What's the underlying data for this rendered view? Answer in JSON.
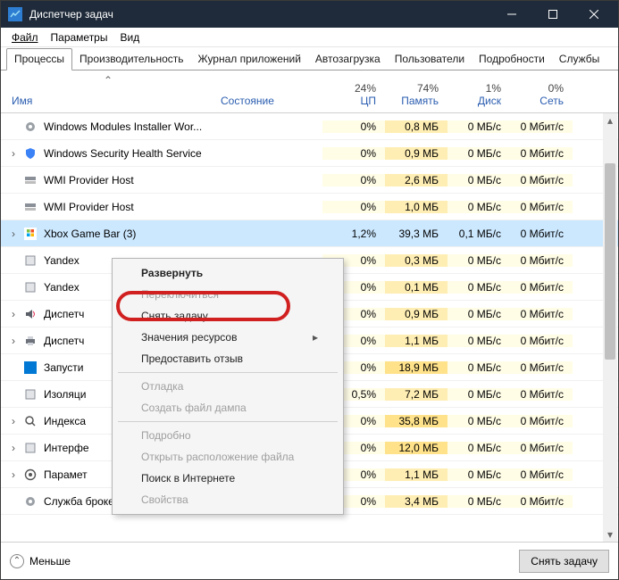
{
  "window": {
    "title": "Диспетчер задач"
  },
  "menu": {
    "file": "Файл",
    "options": "Параметры",
    "view": "Вид"
  },
  "tabs": [
    {
      "label": "Процессы"
    },
    {
      "label": "Производительность"
    },
    {
      "label": "Журнал приложений"
    },
    {
      "label": "Автозагрузка"
    },
    {
      "label": "Пользователи"
    },
    {
      "label": "Подробности"
    },
    {
      "label": "Службы"
    }
  ],
  "columns": {
    "name": "Имя",
    "status": "Состояние",
    "cpu": {
      "pct": "24%",
      "label": "ЦП"
    },
    "memory": {
      "pct": "74%",
      "label": "Память"
    },
    "disk": {
      "pct": "1%",
      "label": "Диск"
    },
    "network": {
      "pct": "0%",
      "label": "Сеть"
    }
  },
  "rows": [
    {
      "expand": "",
      "name": "Windows Modules Installer Wor...",
      "cpu": "0%",
      "mem": "0,8 МБ",
      "disk": "0 МБ/с",
      "net": "0 Мбит/с",
      "m": "1",
      "icon": "cog"
    },
    {
      "expand": "›",
      "name": "Windows Security Health Service",
      "cpu": "0%",
      "mem": "0,9 МБ",
      "disk": "0 МБ/с",
      "net": "0 Мбит/с",
      "m": "1",
      "icon": "shield"
    },
    {
      "expand": "",
      "name": "WMI Provider Host",
      "cpu": "0%",
      "mem": "2,6 МБ",
      "disk": "0 МБ/с",
      "net": "0 Мбит/с",
      "m": "1",
      "icon": "srv"
    },
    {
      "expand": "",
      "name": "WMI Provider Host",
      "cpu": "0%",
      "mem": "1,0 МБ",
      "disk": "0 МБ/с",
      "net": "0 Мбит/с",
      "m": "1",
      "icon": "srv"
    },
    {
      "expand": "›",
      "name": "Xbox Game Bar (3)",
      "cpu": "1,2%",
      "mem": "39,3 МБ",
      "disk": "0,1 МБ/с",
      "net": "0 Мбит/с",
      "m": "2",
      "icon": "xbox",
      "selected": true
    },
    {
      "expand": "",
      "name": "Yandex",
      "cpu": "0%",
      "mem": "0,3 МБ",
      "disk": "0 МБ/с",
      "net": "0 Мбит/с",
      "m": "1",
      "icon": "app"
    },
    {
      "expand": "",
      "name": "Yandex",
      "cpu": "0%",
      "mem": "0,1 МБ",
      "disk": "0 МБ/с",
      "net": "0 Мбит/с",
      "m": "1",
      "icon": "app"
    },
    {
      "expand": "›",
      "name": "Диспетч",
      "cpu": "0%",
      "mem": "0,9 МБ",
      "disk": "0 МБ/с",
      "net": "0 Мбит/с",
      "m": "1",
      "icon": "snd"
    },
    {
      "expand": "›",
      "name": "Диспетч",
      "cpu": "0%",
      "mem": "1,1 МБ",
      "disk": "0 МБ/с",
      "net": "0 Мбит/с",
      "m": "1",
      "icon": "prn"
    },
    {
      "expand": "",
      "name": "Запусти",
      "cpu": "0%",
      "mem": "18,9 МБ",
      "disk": "0 МБ/с",
      "net": "0 Мбит/с",
      "m": "2",
      "icon": "win"
    },
    {
      "expand": "",
      "name": "Изоляци",
      "cpu": "0,5%",
      "mem": "7,2 МБ",
      "disk": "0 МБ/с",
      "net": "0 Мбит/с",
      "m": "1",
      "icon": "app"
    },
    {
      "expand": "›",
      "name": "Индекса",
      "cpu": "0%",
      "mem": "35,8 МБ",
      "disk": "0 МБ/с",
      "net": "0 Мбит/с",
      "m": "2",
      "icon": "idx"
    },
    {
      "expand": "›",
      "name": "Интерфе",
      "cpu": "0%",
      "mem": "12,0 МБ",
      "disk": "0 МБ/с",
      "net": "0 Мбит/с",
      "m": "2",
      "icon": "app"
    },
    {
      "expand": "›",
      "name": "Парамет",
      "cpu": "0%",
      "mem": "1,1 МБ",
      "disk": "0 МБ/с",
      "net": "0 Мбит/с",
      "m": "1",
      "icon": "set"
    },
    {
      "expand": "",
      "name": "Служба брокера мониторинга...",
      "cpu": "0%",
      "mem": "3,4 МБ",
      "disk": "0 МБ/с",
      "net": "0 Мбит/с",
      "m": "1",
      "icon": "cog"
    }
  ],
  "context_menu": [
    {
      "label": "Развернуть",
      "type": "bold"
    },
    {
      "label": "Переключиться",
      "type": "disabled"
    },
    {
      "label": "Снять задачу",
      "type": "normal"
    },
    {
      "label": "Значения ресурсов",
      "type": "submenu"
    },
    {
      "label": "Предоставить отзыв",
      "type": "normal"
    },
    {
      "type": "sep"
    },
    {
      "label": "Отладка",
      "type": "disabled"
    },
    {
      "label": "Создать файл дампа",
      "type": "disabled"
    },
    {
      "type": "sep"
    },
    {
      "label": "Подробно",
      "type": "disabled"
    },
    {
      "label": "Открыть расположение файла",
      "type": "disabled"
    },
    {
      "label": "Поиск в Интернете",
      "type": "normal"
    },
    {
      "label": "Свойства",
      "type": "disabled"
    }
  ],
  "footer": {
    "fewer": "Меньше",
    "end_task": "Снять задачу"
  }
}
